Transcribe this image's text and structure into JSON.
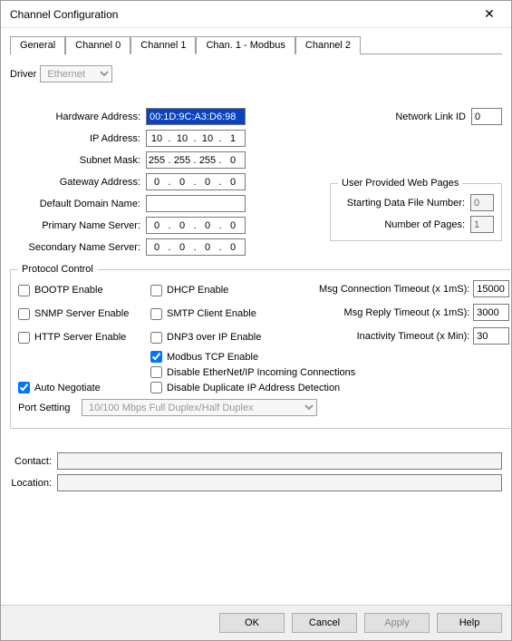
{
  "window": {
    "title": "Channel Configuration",
    "close": "✕"
  },
  "tabs": {
    "general": "General",
    "channel0": "Channel 0",
    "channel1": "Channel 1",
    "chan1modbus": "Chan. 1 - Modbus",
    "channel2": "Channel 2"
  },
  "driver": {
    "label": "Driver",
    "value": "Ethernet"
  },
  "addr": {
    "hw_label": "Hardware Address:",
    "hw_value": "00:1D:9C:A3:D6:98",
    "ip_label": "IP Address:",
    "ip": {
      "a": "10",
      "b": "10",
      "c": "10",
      "d": "1"
    },
    "subnet_label": "Subnet Mask:",
    "subnet": {
      "a": "255",
      "b": "255",
      "c": "255",
      "d": "0"
    },
    "gateway_label": "Gateway Address:",
    "gateway": {
      "a": "0",
      "b": "0",
      "c": "0",
      "d": "0"
    },
    "domain_label": "Default Domain Name:",
    "domain_value": "",
    "pdns_label": "Primary Name Server:",
    "pdns": {
      "a": "0",
      "b": "0",
      "c": "0",
      "d": "0"
    },
    "sdns_label": "Secondary Name Server:",
    "sdns": {
      "a": "0",
      "b": "0",
      "c": "0",
      "d": "0"
    }
  },
  "netlink": {
    "label": "Network Link ID",
    "value": "0"
  },
  "userweb": {
    "legend": "User Provided Web Pages",
    "start_label": "Starting Data File Number:",
    "start_value": "0",
    "pages_label": "Number of Pages:",
    "pages_value": "1"
  },
  "proto": {
    "legend": "Protocol Control",
    "bootp": "BOOTP Enable",
    "dhcp": "DHCP Enable",
    "snmp": "SNMP Server Enable",
    "smtp": "SMTP Client Enable",
    "http": "HTTP Server Enable",
    "dnp3": "DNP3 over IP Enable",
    "modbus": "Modbus TCP Enable",
    "disable_enip": "Disable EtherNet/IP Incoming Connections",
    "disable_dup": "Disable Duplicate IP Address Detection",
    "auto_neg": "Auto Negotiate",
    "port_label": "Port Setting",
    "port_value": "10/100 Mbps Full Duplex/Half Duplex",
    "msg_conn_label": "Msg Connection Timeout (x 1mS):",
    "msg_conn_value": "15000",
    "msg_reply_label": "Msg Reply Timeout (x 1mS):",
    "msg_reply_value": "3000",
    "inactivity_label": "Inactivity Timeout (x Min):",
    "inactivity_value": "30"
  },
  "contact": {
    "label": "Contact:",
    "value": ""
  },
  "location": {
    "label": "Location:",
    "value": ""
  },
  "buttons": {
    "ok": "OK",
    "cancel": "Cancel",
    "apply": "Apply",
    "help": "Help"
  }
}
